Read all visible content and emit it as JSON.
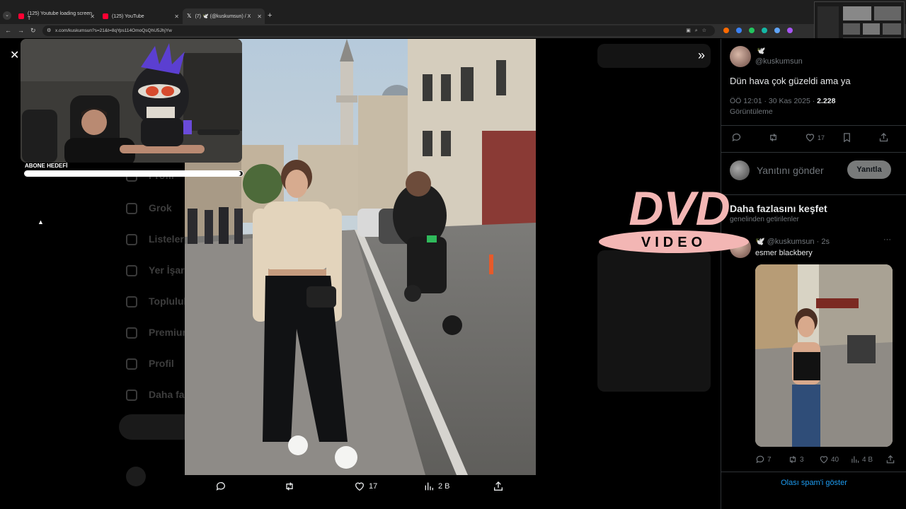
{
  "browser": {
    "tabs": [
      {
        "title": "(125) Youtube loading screen T",
        "type": "yt"
      },
      {
        "title": "(125) YouTube",
        "type": "yt"
      },
      {
        "title": "(7) 🕊️ (@kuskumsun) / X",
        "type": "x"
      }
    ],
    "new_tab": "+",
    "url": "x.com/kuskumsun?s=21&t=8qYps114OmoQsQhU5JhjYw"
  },
  "viewer": {
    "close": "✕",
    "expand": "»",
    "actions": {
      "comments": "",
      "retweets": "",
      "likes": "17",
      "views": "2 B",
      "share": ""
    }
  },
  "stream": {
    "subscriber_goal_label": "ABONE HEDEFİ",
    "subscriber_goal_progress": 0.99
  },
  "tweet": {
    "emoji": "🕊️",
    "handle": "@kuskumsun",
    "text": "Dün hava çok güzeldi ama ya",
    "time": "ÖÖ 12:01 · 30 Kas 2025 · ",
    "views_count": "2.228",
    "views_label": "Görüntüleme",
    "likes": "17"
  },
  "reply": {
    "placeholder": "Yanıtını gönder",
    "button": "Yanıtla"
  },
  "discover": {
    "title": "Daha fazlasını keşfet",
    "subtitle": "genelinden getirilenler"
  },
  "related_tweet": {
    "header": "🕊️ @kuskumsun · 2s",
    "more": "···",
    "text": "esmer blackbery",
    "replies": "7",
    "retweets": "3",
    "likes": "40",
    "views": "4 B"
  },
  "spam_link": "Olası spam'i göster",
  "overlay": {
    "dvd_top": "DVD",
    "dvd_bottom": "VIDEO"
  },
  "background_nav": [
    "Profil",
    "Grok",
    "Listeler",
    "Yer İşaretleri",
    "Topluluklar",
    "Premium",
    "Profil",
    "Daha fazla"
  ],
  "colors": {
    "accent": "#1d9bf0",
    "dvd": "#f3b6b4"
  }
}
